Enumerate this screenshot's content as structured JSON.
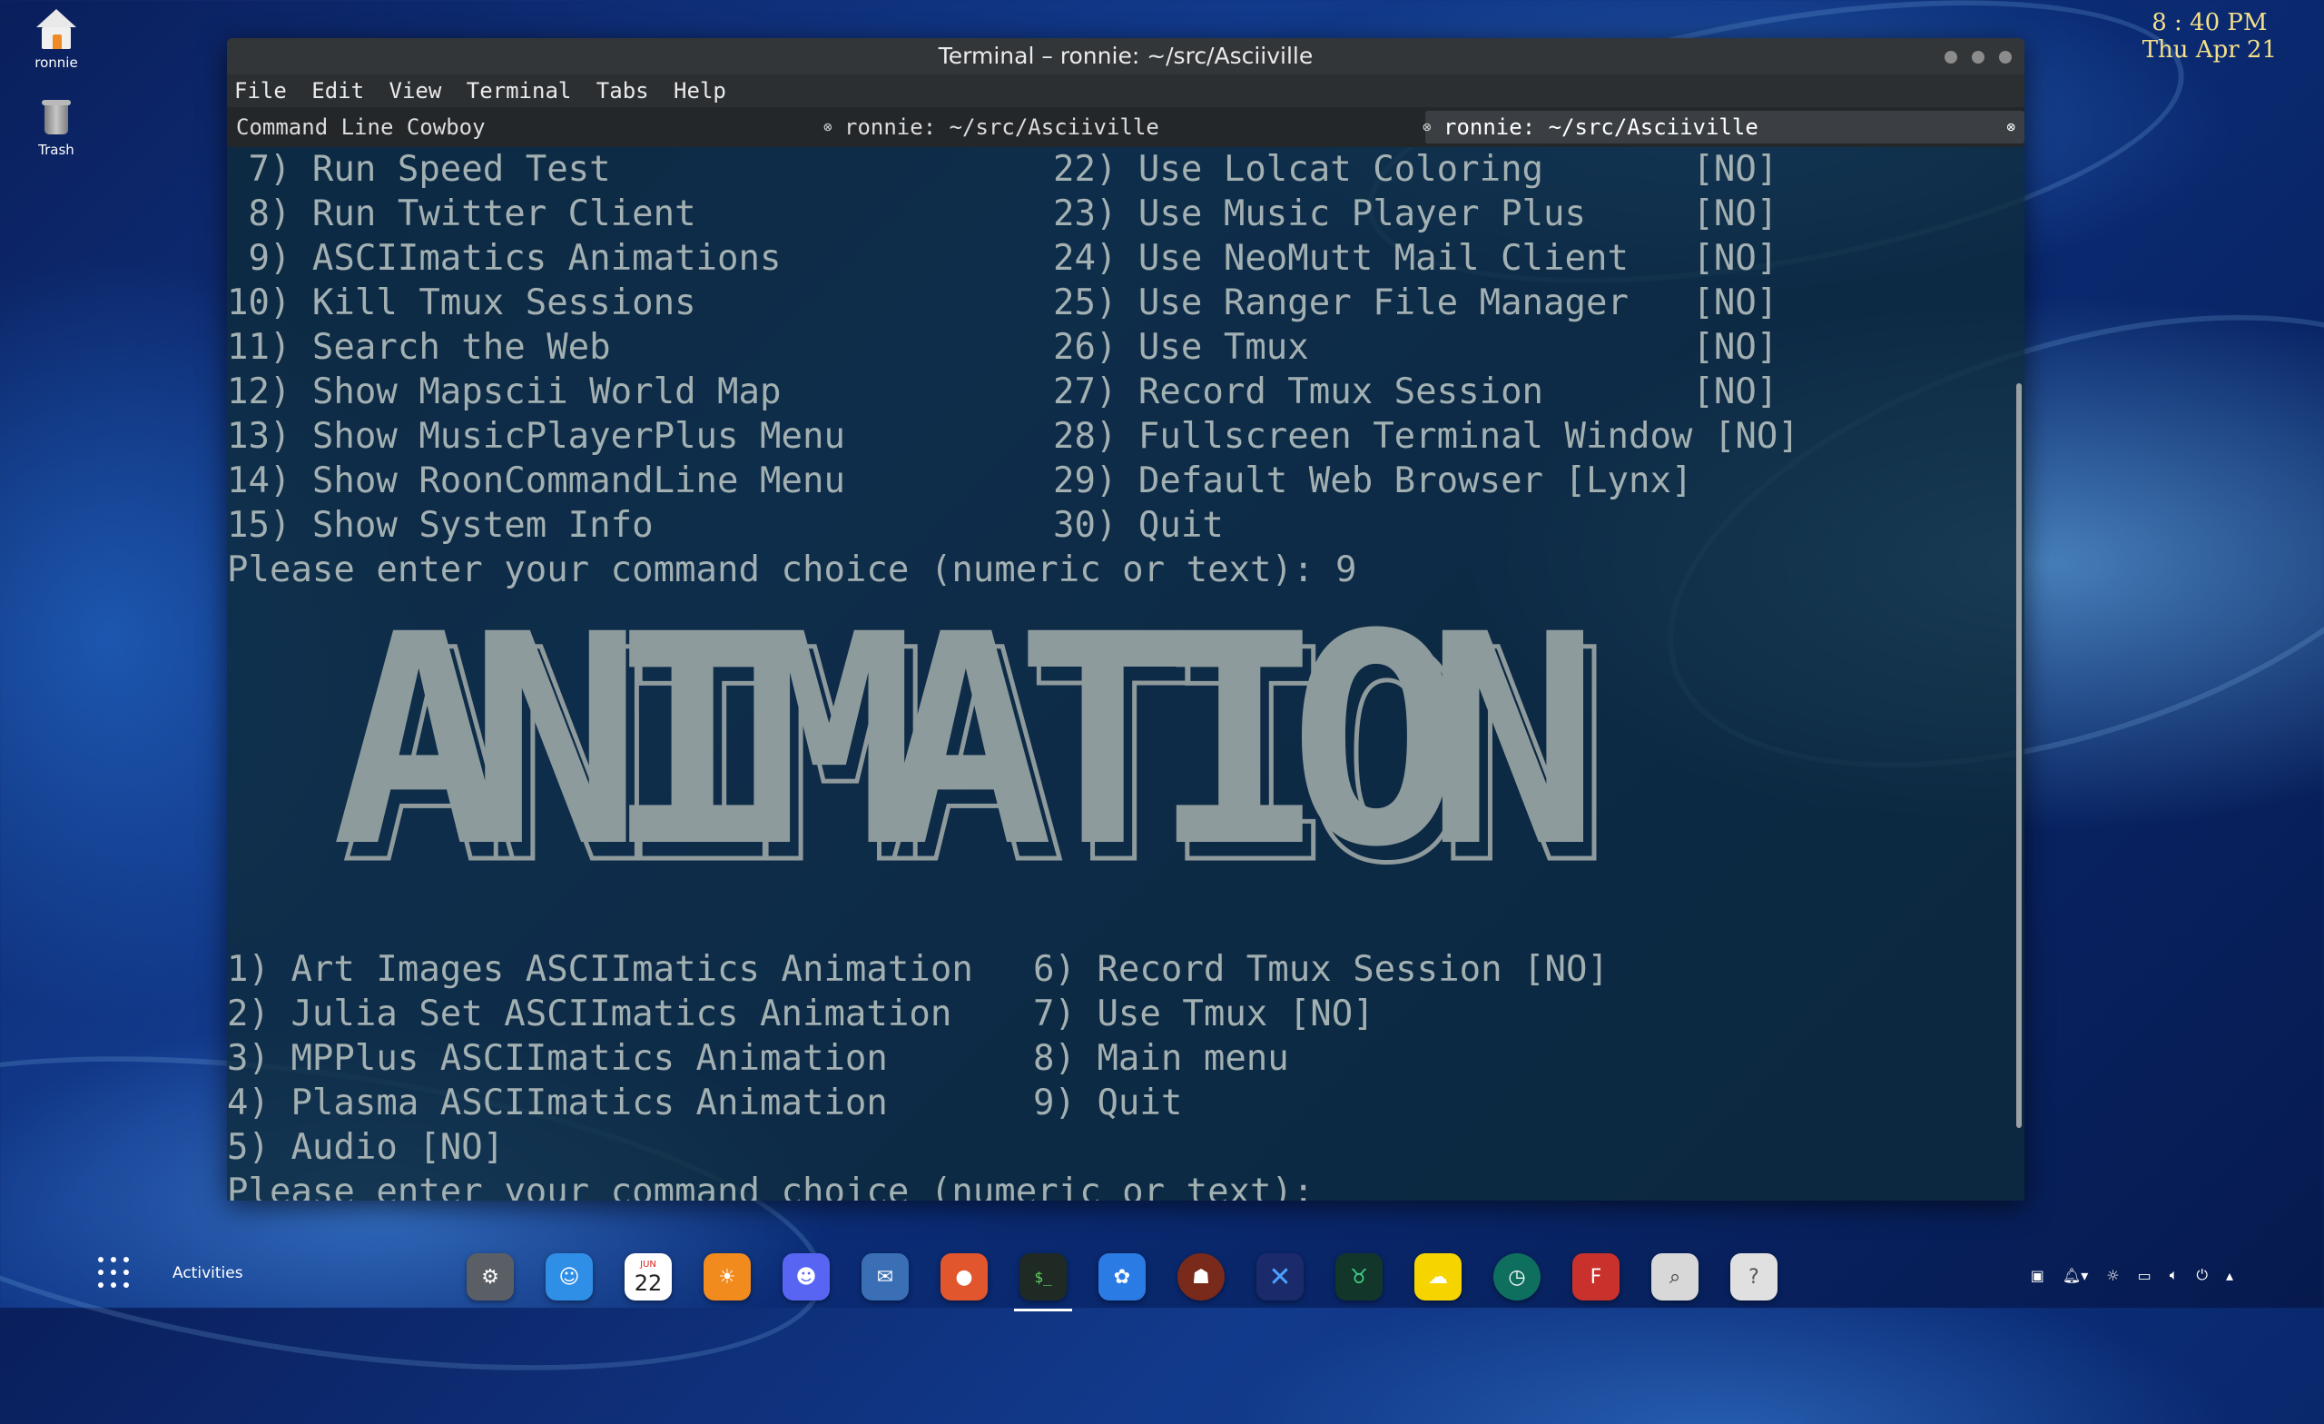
{
  "desktop": {
    "icons": [
      {
        "label": "ronnie",
        "icon": "home-folder-icon"
      },
      {
        "label": "Trash",
        "icon": "trash-icon"
      }
    ],
    "clock": {
      "time": "8 : 40 PM",
      "date": "Thu Apr 21"
    }
  },
  "window": {
    "title": "Terminal – ronnie: ~/src/Asciiville",
    "menu": [
      "File",
      "Edit",
      "View",
      "Terminal",
      "Tabs",
      "Help"
    ],
    "tabs": [
      {
        "label": "Command Line Cowboy",
        "active": false
      },
      {
        "label": "ronnie: ~/src/Asciiville",
        "active": false
      },
      {
        "label": "ronnie: ~/src/Asciiville",
        "active": true
      }
    ]
  },
  "terminal": {
    "menu_left": [
      " 7) Run Speed Test",
      " 8) Run Twitter Client",
      " 9) ASCIImatics Animations",
      "10) Kill Tmux Sessions",
      "11) Search the Web",
      "12) Show Mapscii World Map",
      "13) Show MusicPlayerPlus Menu",
      "14) Show RoonCommandLine Menu",
      "15) Show System Info"
    ],
    "menu_right": [
      "22) Use Lolcat Coloring       [NO]",
      "23) Use Music Player Plus     [NO]",
      "24) Use NeoMutt Mail Client   [NO]",
      "25) Use Ranger File Manager   [NO]",
      "26) Use Tmux                  [NO]",
      "27) Record Tmux Session       [NO]",
      "28) Fullscreen Terminal Window [NO]",
      "29) Default Web Browser [Lynx]",
      "30) Quit"
    ],
    "prompt1": "Please enter your command choice (numeric or text): 9",
    "banner": "ANIMATION",
    "sub_left": [
      "1) Art Images ASCIImatics Animation",
      "2) Julia Set ASCIImatics Animation",
      "3) MPPlus ASCIImatics Animation",
      "4) Plasma ASCIImatics Animation",
      "5) Audio [NO]"
    ],
    "sub_right": [
      "6) Record Tmux Session [NO]",
      "7) Use Tmux [NO]",
      "8) Main menu",
      "9) Quit"
    ],
    "prompt2": "Please enter your command choice (numeric or text): "
  },
  "taskbar": {
    "activities_label": "Activities",
    "calendar_month": "JUN",
    "calendar_day": "22",
    "dock": [
      {
        "name": "system-settings-icon",
        "color": "#5a5f66"
      },
      {
        "name": "finder-icon",
        "color": "#2f8ee6"
      },
      {
        "name": "calendar-icon",
        "color": "#ffffff"
      },
      {
        "name": "sun-app-icon",
        "color": "#f28b1e"
      },
      {
        "name": "discord-icon",
        "color": "#5865f2"
      },
      {
        "name": "thunderbird-icon",
        "color": "#3a6fb5"
      },
      {
        "name": "firefox-icon",
        "color": "#e2562e"
      },
      {
        "name": "terminal-icon",
        "color": "#1f2a24"
      },
      {
        "name": "paw-app-icon",
        "color": "#2a7be4"
      },
      {
        "name": "game-avatar-icon",
        "color": "#7a2a1a"
      },
      {
        "name": "x-app-icon",
        "color": "#1b2a6b"
      },
      {
        "name": "bull-app-icon",
        "color": "#12362a"
      },
      {
        "name": "cloud-app-icon",
        "color": "#f5d400"
      },
      {
        "name": "time-shift-icon",
        "color": "#0f6f5f"
      },
      {
        "name": "filezilla-icon",
        "color": "#c9312c"
      },
      {
        "name": "search-tool-icon",
        "color": "#d8d8d8"
      },
      {
        "name": "help-icon",
        "color": "#e0e0e0"
      }
    ],
    "tray": [
      "window-icon",
      "notification-icon",
      "settings-icon",
      "display-icon",
      "volume-icon",
      "power-icon",
      "chevron-up-icon"
    ]
  }
}
